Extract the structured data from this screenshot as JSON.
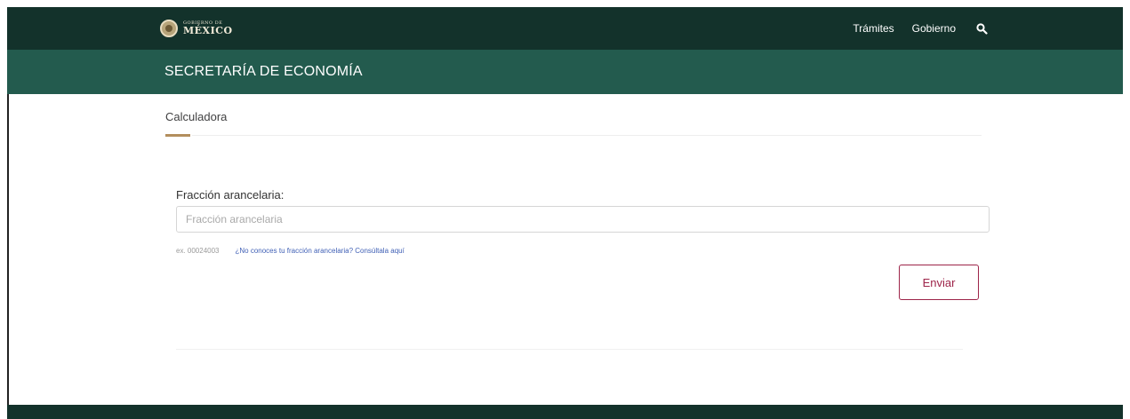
{
  "header": {
    "logo_top": "GOBIERNO DE",
    "logo_main": "MÉXICO",
    "nav": [
      "Trámites",
      "Gobierno"
    ],
    "search_icon": "search-icon"
  },
  "subheader": {
    "title": "SECRETARÍA DE ECONOMÍA"
  },
  "breadcrumb": {
    "label": "Calculadora"
  },
  "form": {
    "label": "Fracción arancelaria:",
    "input_value": "",
    "input_placeholder": "Fracción arancelaria",
    "example_text": "ex. 00024003",
    "help_link": "¿No conoces tu fracción arancelaria? Consúltala aquí",
    "submit_label": "Enviar"
  },
  "colors": {
    "topbar": "#13322b",
    "subbar": "#235b4e",
    "accent_gold": "#b38e5d",
    "button": "#9d2449",
    "link": "#3f5fb5"
  }
}
